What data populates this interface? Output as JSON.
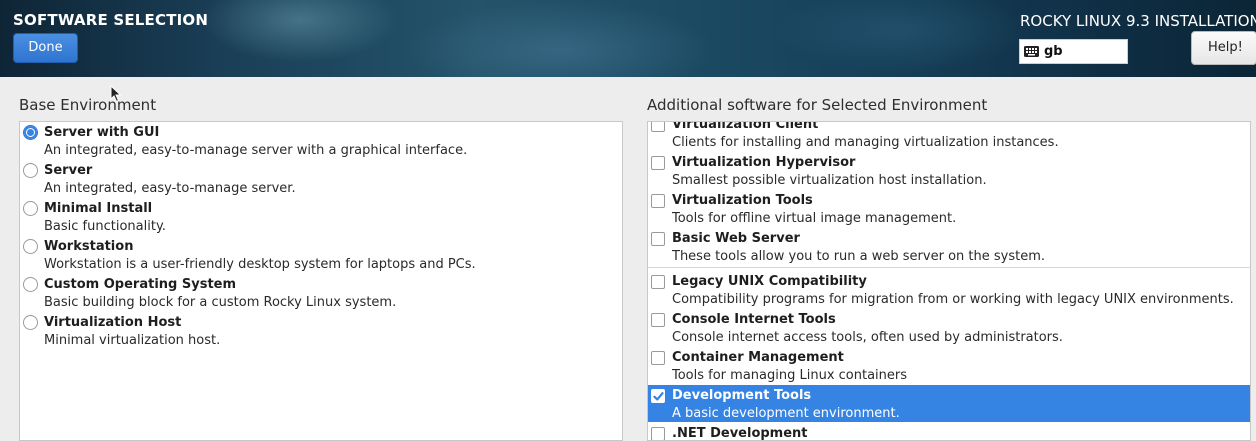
{
  "header": {
    "title": "SOFTWARE SELECTION",
    "done_label": "Done",
    "install_title": "ROCKY LINUX 9.3 INSTALLATION",
    "keyboard_layout": "gb",
    "help_label": "Help!"
  },
  "base_environment": {
    "heading": "Base Environment",
    "items": [
      {
        "title": "Server with GUI",
        "desc": "An integrated, easy-to-manage server with a graphical interface.",
        "selected": true
      },
      {
        "title": "Server",
        "desc": "An integrated, easy-to-manage server.",
        "selected": false
      },
      {
        "title": "Minimal Install",
        "desc": "Basic functionality.",
        "selected": false
      },
      {
        "title": "Workstation",
        "desc": "Workstation is a user-friendly desktop system for laptops and PCs.",
        "selected": false
      },
      {
        "title": "Custom Operating System",
        "desc": "Basic building block for a custom Rocky Linux system.",
        "selected": false
      },
      {
        "title": "Virtualization Host",
        "desc": "Minimal virtualization host.",
        "selected": false
      }
    ]
  },
  "additional_software": {
    "heading": "Additional software for Selected Environment",
    "items": [
      {
        "title": "Virtualization Client",
        "desc": "Clients for installing and managing virtualization instances.",
        "checked": false
      },
      {
        "title": "Virtualization Hypervisor",
        "desc": "Smallest possible virtualization host installation.",
        "checked": false
      },
      {
        "title": "Virtualization Tools",
        "desc": "Tools for offline virtual image management.",
        "checked": false
      },
      {
        "title": "Basic Web Server",
        "desc": "These tools allow you to run a web server on the system.",
        "checked": false
      },
      {
        "title": "Legacy UNIX Compatibility",
        "desc": "Compatibility programs for migration from or working with legacy UNIX environments.",
        "checked": false
      },
      {
        "title": "Console Internet Tools",
        "desc": "Console internet access tools, often used by administrators.",
        "checked": false
      },
      {
        "title": "Container Management",
        "desc": "Tools for managing Linux containers",
        "checked": false
      },
      {
        "title": "Development Tools",
        "desc": "A basic development environment.",
        "checked": true,
        "highlighted": true
      },
      {
        "title": ".NET Development",
        "desc": "",
        "checked": false
      }
    ]
  },
  "colors": {
    "accent": "#3584e4",
    "background": "#ededed"
  }
}
